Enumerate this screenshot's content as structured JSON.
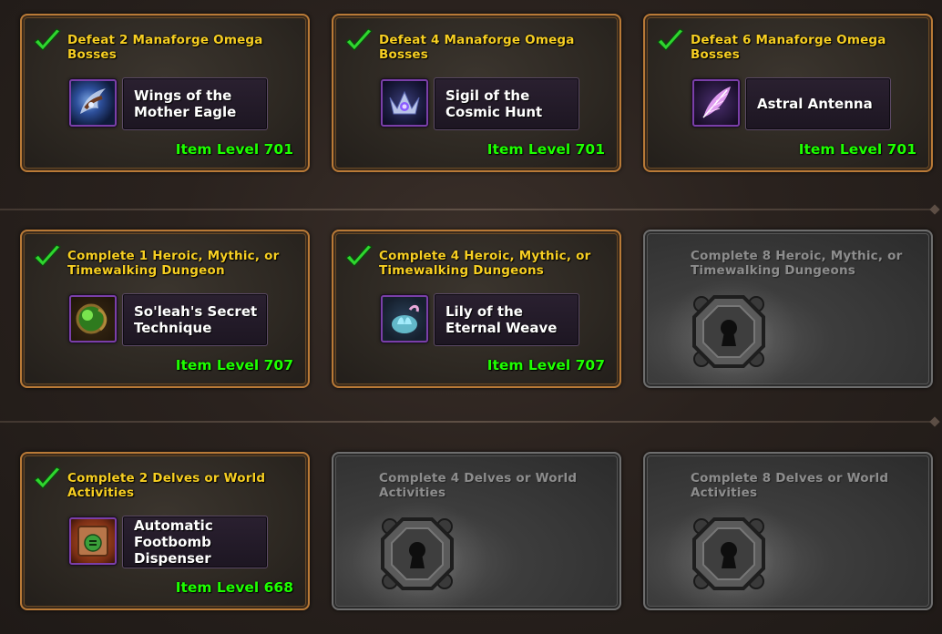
{
  "cards": [
    {
      "state": "unlocked",
      "title": "Defeat 2 Manaforge Omega Bosses",
      "reward": "Wings of the Mother Eagle",
      "icon": "wings-icon",
      "item_level": "Item Level 701"
    },
    {
      "state": "unlocked",
      "title": "Defeat 4 Manaforge Omega Bosses",
      "reward": "Sigil of the Cosmic Hunt",
      "icon": "sigil-icon",
      "item_level": "Item Level 701"
    },
    {
      "state": "unlocked",
      "title": "Defeat 6 Manaforge Omega Bosses",
      "reward": "Astral Antenna",
      "icon": "feather-icon",
      "item_level": "Item Level 701"
    },
    {
      "state": "unlocked",
      "title": "Complete 1 Heroic, Mythic, or Timewalking Dungeon",
      "reward": "So'leah's Secret Technique",
      "icon": "green-orb-icon",
      "item_level": "Item Level 707"
    },
    {
      "state": "unlocked",
      "title": "Complete 4 Heroic, Mythic, or Timewalking Dungeons",
      "reward": "Lily of the Eternal Weave",
      "icon": "lily-icon",
      "item_level": "Item Level 707"
    },
    {
      "state": "locked",
      "title": "Complete 8 Heroic, Mythic, or Timewalking Dungeons",
      "icon": "padlock-icon"
    },
    {
      "state": "unlocked",
      "title": "Complete 2 Delves or World Activities",
      "reward": "Automatic Footbomb Dispenser",
      "icon": "footbomb-icon",
      "item_level": "Item Level 668"
    },
    {
      "state": "locked",
      "title": "Complete 4 Delves or World Activities",
      "icon": "padlock-icon"
    },
    {
      "state": "locked",
      "title": "Complete 8 Delves or World Activities",
      "icon": "padlock-icon"
    }
  ],
  "colors": {
    "title_unlocked": "#f7cf22",
    "title_locked": "#8d8d8d",
    "item_level": "#1eff00",
    "border_unlocked": "#b97a37",
    "border_locked": "#6e6e6e",
    "checkmark": "#2fd62f"
  }
}
